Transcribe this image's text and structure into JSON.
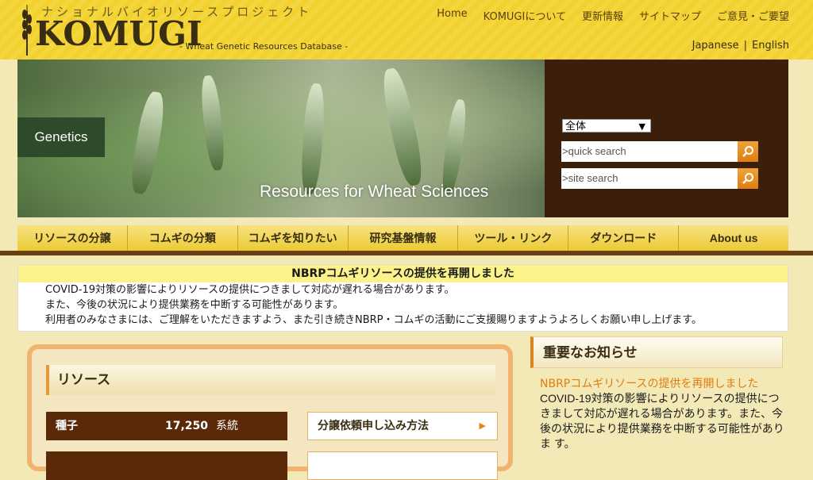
{
  "brand": {
    "kana": "ナショナルバイオリソースプロジェクト",
    "name": "KOMUGI",
    "subtitle": "- Wheat Genetic Resources Database -"
  },
  "topnav": [
    "Home",
    "KOMUGIについて",
    "更新情報",
    "サイトマップ",
    "ご意見・ご要望"
  ],
  "lang": {
    "ja": "Japanese",
    "sep": "|",
    "en": "English"
  },
  "hero": {
    "label": "Genetics",
    "caption": "Resources for Wheat Sciences"
  },
  "search": {
    "scope": "全体",
    "quick_placeholder": ">quick search",
    "site_placeholder": ">site search"
  },
  "mainnav": [
    "リソースの分譲",
    "コムギの分類",
    "コムギを知りたい",
    "研究基盤情報",
    "ツール・リンク",
    "ダウンロード",
    "About us"
  ],
  "notice": {
    "title": "NBRPコムギリソースの提供を再開しました",
    "lines": [
      "COVID-19対策の影響によりリソースの提供につきまして対応が遅れる場合があります。",
      "また、今後の状況により提供業務を中断する可能性があります。",
      "利用者のみなさまには、ご理解をいただきますよう、また引き続きNBRP・コムギの活動にご支援賜りますようよろしくお願い申し上げます。"
    ]
  },
  "resources": {
    "title": "リソース",
    "rows": [
      {
        "name": "種子",
        "count": "17,250",
        "unit": "系統"
      }
    ],
    "link": "分譲依頼申し込み方法"
  },
  "news": {
    "heading": "重要なお知らせ",
    "title": "NBRPコムギリソースの提供を再開しました",
    "body": "COVID-19対策の影響によりリソースの提供につきまして対応が遅れる場合があります。また、今後の状況により提供業務を中断する可能性がありま す。"
  }
}
